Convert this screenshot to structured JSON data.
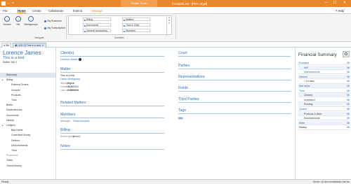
{
  "titlebar": {
    "context_tab": "Matter Tools",
    "title": "ContactsLive - [PEH Legal]",
    "minimize": "—",
    "maximize": "☐",
    "close": "✕"
  },
  "tabs": [
    "File",
    "Home",
    "Create",
    "Collaborate",
    "Extend",
    "Manage"
  ],
  "help_label": "Help",
  "ribbon": {
    "search_label": "Search",
    "me_label": "Me",
    "workgroups_label": "Workgroups",
    "my_business_label": "My Business",
    "my_subscription_label": "My Subscription",
    "navigate_label": "Navigate",
    "activities_label": "Activities",
    "gallery_col1": [
      "Billing",
      "Documents",
      "General Accounting"
    ],
    "gallery_col2": [
      "Matters",
      "Trust & CMA",
      "Workflow"
    ]
  },
  "doc_tabs": {
    "me": "Me",
    "matter": "[100-2] This is a test."
  },
  "sidebar": {
    "client_name": "Lorence James",
    "matter_title": "This is a test.",
    "matter_no": "Matter 100-2",
    "items": [
      {
        "label": "Summary",
        "indent": 0,
        "toggle": "",
        "selected": true,
        "grey": false
      },
      {
        "label": "Billing",
        "indent": 0,
        "toggle": "▲",
        "selected": false,
        "grey": false
      },
      {
        "label": "External Orders",
        "indent": 1,
        "toggle": "",
        "selected": false,
        "grey": false
      },
      {
        "label": "Invoices",
        "indent": 1,
        "toggle": "",
        "selected": false,
        "grey": false
      },
      {
        "label": "Products",
        "indent": 1,
        "toggle": "",
        "selected": false,
        "grey": false
      },
      {
        "label": "Time",
        "indent": 1,
        "toggle": "",
        "selected": false,
        "grey": false
      },
      {
        "label": "Briefs",
        "indent": 0,
        "toggle": "",
        "selected": false,
        "grey": false
      },
      {
        "label": "Dependencies",
        "indent": 0,
        "toggle": "",
        "selected": false,
        "grey": false
      },
      {
        "label": "Documents",
        "indent": 0,
        "toggle": "",
        "selected": false,
        "grey": false
      },
      {
        "label": "History",
        "indent": 0,
        "toggle": "",
        "selected": false,
        "grey": false
      },
      {
        "label": "Ledgers",
        "indent": 0,
        "toggle": "▲",
        "selected": false,
        "grey": false
      },
      {
        "label": "Bad Debts",
        "indent": 1,
        "toggle": "",
        "selected": false,
        "grey": false
      },
      {
        "label": "Controlled Money",
        "indent": 1,
        "toggle": "",
        "selected": false,
        "grey": false
      },
      {
        "label": "Debtors",
        "indent": 1,
        "toggle": "",
        "selected": false,
        "grey": false
      },
      {
        "label": "Disbursements",
        "indent": 1,
        "toggle": "",
        "selected": false,
        "grey": false
      },
      {
        "label": "Trust",
        "indent": 1,
        "toggle": "",
        "selected": false,
        "grey": false
      },
      {
        "label": "Processes",
        "indent": 0,
        "toggle": "",
        "selected": false,
        "grey": true
      },
      {
        "label": "Tasks",
        "indent": 0,
        "toggle": "",
        "selected": false,
        "grey": false
      },
      {
        "label": "Transit Money",
        "indent": 0,
        "toggle": "",
        "selected": false,
        "grey": false
      }
    ]
  },
  "main": {
    "clients_heading": "Client(s)",
    "client_link": "Lorence James",
    "matter_heading": "Matter",
    "matter_title": "This is a test.",
    "matter_type": "Demo Workgroup",
    "fields": [
      {
        "label": "Storage",
        "value": "Digital"
      },
      {
        "label": "Created on",
        "value": "11/6/2024"
      },
      {
        "label": "Last modified on",
        "value": "21/6/2024"
      }
    ],
    "related_heading": "Related Matters",
    "members_heading": "Members",
    "manager_label": "Manager",
    "manager_value": "Guest Account",
    "billing_heading": "Billing",
    "active_quote_label": "Active quote",
    "active_quote_value": "(none)",
    "notes_heading": "Notes",
    "court_heading": "Court",
    "parties_heading": "Parties",
    "representatives_heading": "Representatives",
    "fields_heading": "Fields",
    "third_parties_heading": "Third Parties",
    "tags_heading": "Tags",
    "tag": "test"
  },
  "financial": {
    "title": "Financial Summary",
    "gear": "⚙",
    "rows": [
      {
        "name": "Exposure",
        "amount": "Nil",
        "indent": 0,
        "dark": false,
        "alt": false
      },
      {
        "name": "WIP",
        "amount": "Nil",
        "indent": 1,
        "dark": false,
        "alt": true
      },
      {
        "name": "Disbursements",
        "amount": "Nil",
        "indent": 1,
        "dark": false,
        "alt": false
      },
      {
        "name": "Debtors",
        "amount": "Nil",
        "indent": 0,
        "dark": false,
        "alt": true
      },
      {
        "name": "> 14 days",
        "amount": "Nil",
        "indent": 1,
        "dark": true,
        "alt": false
      },
      {
        "name": "Bad debts",
        "amount": "Nil",
        "indent": 0,
        "dark": false,
        "alt": true
      },
      {
        "name": "Trust",
        "amount": "Nil",
        "indent": 0,
        "dark": false,
        "alt": false
      },
      {
        "name": "Cleared",
        "amount": "Nil",
        "indent": 1,
        "dark": true,
        "alt": true
      },
      {
        "name": "Uncleared",
        "amount": "Nil",
        "indent": 1,
        "dark": true,
        "alt": false
      },
      {
        "name": "Pending",
        "amount": "Nil",
        "indent": 1,
        "dark": true,
        "alt": true
      },
      {
        "name": "Quoted",
        "amount": "Nil",
        "indent": 0,
        "dark": false,
        "alt": false
      },
      {
        "name": "Products & other",
        "amount": "Nil",
        "indent": 1,
        "dark": true,
        "alt": true
      },
      {
        "name": "Disbursements",
        "amount": "Nil",
        "indent": 1,
        "dark": true,
        "alt": false
      },
      {
        "name": "Billed",
        "amount": "Nil",
        "indent": 0,
        "dark": false,
        "alt": true
      },
      {
        "name": "Markup",
        "amount": "Nil",
        "indent": 0,
        "dark": true,
        "alt": false
      }
    ]
  },
  "status": {
    "left": "Ready",
    "right": "Server: v2-dev.contactslaw.com.au"
  }
}
